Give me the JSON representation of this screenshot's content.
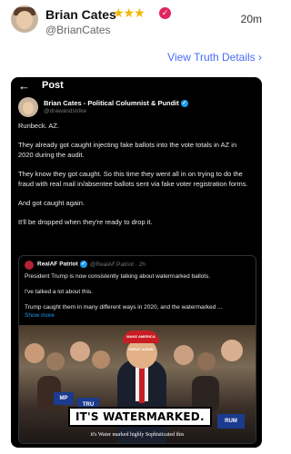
{
  "header": {
    "name": "Brian Cates",
    "stars": "★★★",
    "verified_icon": "verified-badge-icon",
    "handle": "@BrianCates",
    "time": "20m",
    "view_link": "View Truth Details ›"
  },
  "embedded_post": {
    "back_icon": "←",
    "label": "Post",
    "author_name": "Brian Cates - Political Columnist & Pundit",
    "author_handle": "@drawandstrike",
    "paragraphs": [
      "Runbeck.  AZ.",
      "They already got caught injecting fake ballots into the vote totals in AZ in 2020 during the audit.",
      "They know they got caught. So this time they went all in on trying to do the fraud with real mail in/absentee ballots sent via fake voter registration forms.",
      "And got caught again.",
      "It'll be dropped when they're ready to drop it."
    ],
    "quote": {
      "author_name": "RealAF Patriot",
      "author_handle": "@RealAF.Patriot · 2h",
      "lines": [
        "President Trump is now consistently talking about watermarked ballots.",
        "I've talked a lot about this.",
        "Trump caught them in many different ways in 2020, and the watermarked ..."
      ],
      "show_more": "Show more",
      "video": {
        "hat_text": "MAKE AMERICA GREAT AGAIN",
        "sign_left": "MP",
        "sign_mid": "TRU",
        "sign_right": "RUM",
        "caption": "IT'S WATERMARKED.",
        "subtitle": "it's Water marked highly Sophisticated this"
      }
    }
  },
  "colors": {
    "accent": "#4a6cf7",
    "verified": "#e0245e",
    "twitter_blue": "#1d9bf0",
    "card_bg": "#000000"
  }
}
